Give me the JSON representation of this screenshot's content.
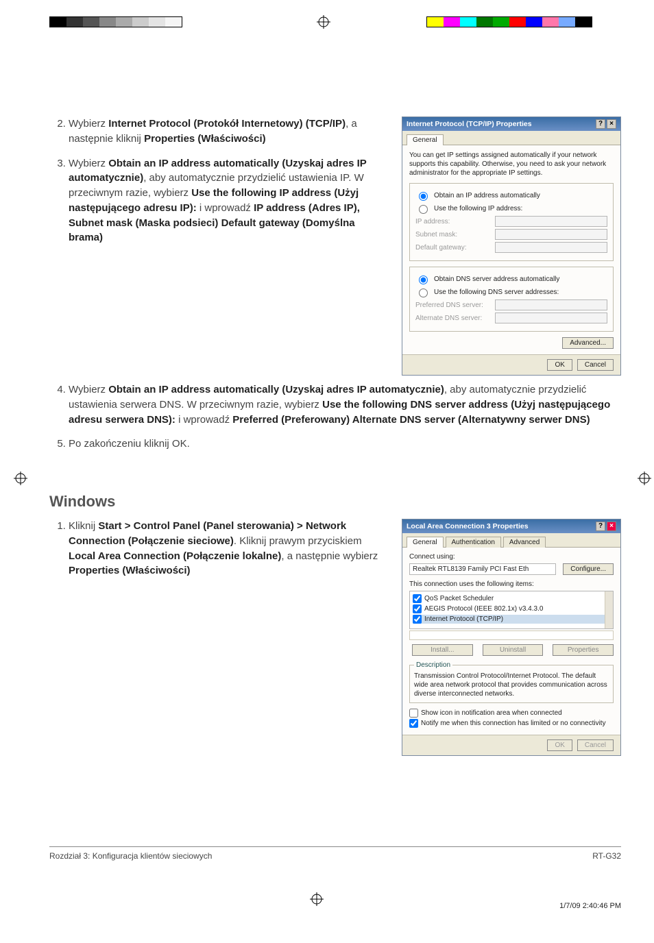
{
  "steps_top": {
    "s2": {
      "lead": "Wybierz ",
      "b1": "Internet Protocol (Protokół Internetowy) (TCP/IP)",
      "mid": ", a następnie kliknij ",
      "b2": "Properties (Właściwości)"
    },
    "s3": {
      "lead": "Wybierz ",
      "b1": "Obtain an IP address automatically (Uzyskaj adres IP automatycznie)",
      "mid": ", aby automatycznie przydzielić ustawienia IP. W przeciwnym razie, wybierz ",
      "b2": "Use the following IP address (Użyj następującego adresu IP):",
      "mid2": " i wprowadź ",
      "b3": "IP address (Adres IP), Subnet mask (Maska podsieci)   Default gateway (Domyślna brama)"
    },
    "s4": {
      "lead": "Wybierz ",
      "b1": "Obtain an IP address automatically (Uzyskaj adres IP automatycznie)",
      "mid": ", aby automatycznie przydzielić ustawienia serwera DNS. W przeciwnym razie, wybierz ",
      "b2": "Use the following DNS server address (Użyj następującego adresu serwera DNS):",
      "mid2": " i wprowadź ",
      "b3": "Preferred (Preferowany)   Alternate DNS server (Alternatywny serwer DNS)"
    },
    "s5": "Po zakończeniu kliknij OK."
  },
  "dialog1": {
    "title": "Internet Protocol (TCP/IP) Properties",
    "tab_general": "General",
    "desc": "You can get IP settings assigned automatically if your network supports this capability. Otherwise, you need to ask your network administrator for the appropriate IP settings.",
    "r_obtain_ip": "Obtain an IP address automatically",
    "r_use_ip": "Use the following IP address:",
    "lbl_ip": "IP address:",
    "lbl_subnet": "Subnet mask:",
    "lbl_gw": "Default gateway:",
    "r_obtain_dns": "Obtain DNS server address automatically",
    "r_use_dns": "Use the following DNS server addresses:",
    "lbl_pref": "Preferred DNS server:",
    "lbl_alt": "Alternate DNS server:",
    "btn_adv": "Advanced...",
    "btn_ok": "OK",
    "btn_cancel": "Cancel"
  },
  "section2_heading": "Windows",
  "section2_step1": {
    "lead": "Kliknij ",
    "b1": "Start > Control Panel (Panel sterowania) > Network Connection (Połączenie sieciowe)",
    "mid": ". Kliknij prawym przyciskiem ",
    "b2": "Local Area Connection (Połączenie lokalne)",
    "mid2": ", a następnie wybierz ",
    "b3": "Properties (Właściwości)"
  },
  "dialog2": {
    "title": "Local Area Connection 3 Properties",
    "tabs": [
      "General",
      "Authentication",
      "Advanced"
    ],
    "connect_using_label": "Connect using:",
    "connect_using_value": "Realtek RTL8139 Family PCI Fast Eth",
    "btn_configure": "Configure...",
    "items_label": "This connection uses the following items:",
    "items": [
      "QoS Packet Scheduler",
      "AEGIS Protocol (IEEE 802.1x) v3.4.3.0",
      "Internet Protocol (TCP/IP)"
    ],
    "btn_install": "Install...",
    "btn_uninstall": "Uninstall",
    "btn_props": "Properties",
    "desc_legend": "Description",
    "desc_text": "Transmission Control Protocol/Internet Protocol. The default wide area network protocol that provides communication across diverse interconnected networks.",
    "chk_showicon": "Show icon in notification area when connected",
    "chk_notify": "Notify me when this connection has limited or no connectivity",
    "btn_ok": "OK",
    "btn_cancel": "Cancel"
  },
  "footer_left": "Rozdział 3: Konfiguracja klientów sieciowych",
  "footer_right": "RT-G32",
  "page_number": "",
  "print_info": "1/7/09   2:40:46 PM"
}
